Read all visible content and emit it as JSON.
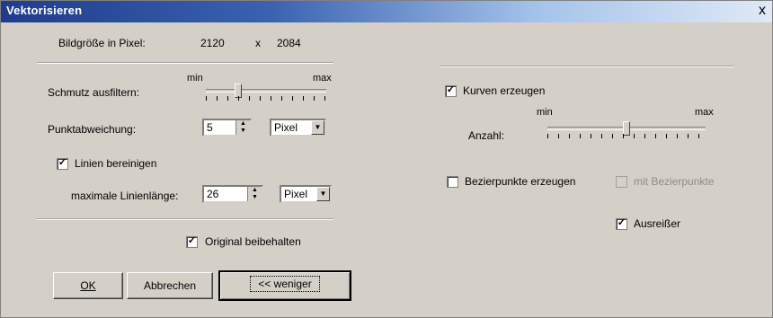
{
  "window": {
    "title": "Vektorisieren",
    "close_glyph": "x"
  },
  "image_size": {
    "label": "Bildgröße in Pixel:",
    "width": "2120",
    "separator": "x",
    "height": "2084"
  },
  "smoothing": {
    "label": "Schmutz ausfiltern:",
    "min": "min",
    "max": "max",
    "level": 0.25
  },
  "point_deviation": {
    "label": "Punktabweichung:",
    "value": "5",
    "unit": "Pixel"
  },
  "clean_lines": {
    "label": "Linien bereinigen",
    "checked": true
  },
  "max_line_length": {
    "label": "maximale Linienlänge:",
    "value": "26",
    "unit": "Pixel"
  },
  "keep_original": {
    "label": "Original beibehalten",
    "checked": true
  },
  "create_curves": {
    "label": "Kurven erzeugen",
    "checked": true
  },
  "count": {
    "label": "Anzahl:",
    "min": "min",
    "max": "max",
    "level": 0.5
  },
  "bezier_points": {
    "label": "Bezierpunkte erzeugen",
    "checked": false
  },
  "bezier_extra": {
    "label": "mit Bezierpunkte",
    "checked": false,
    "enabled": false
  },
  "outliers": {
    "label": "Ausreißer",
    "checked": true
  },
  "buttons": {
    "ok": "OK",
    "cancel": "Abbrechen",
    "less": "<< weniger"
  },
  "icons": {
    "checkmark": "check-mark-icon",
    "spin_up": "up-arrow-icon",
    "spin_down": "down-arrow-icon",
    "dropdown": "chevron-down-icon"
  }
}
